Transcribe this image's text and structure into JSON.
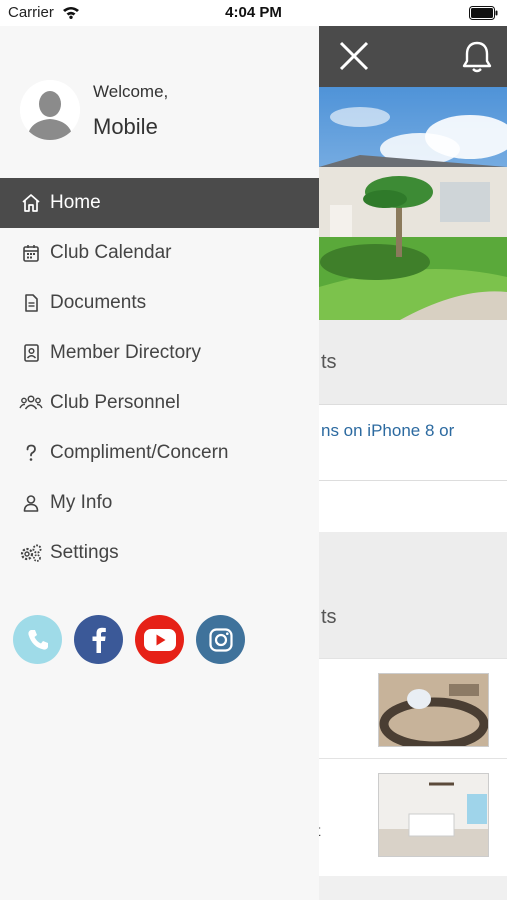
{
  "status_bar": {
    "carrier": "Carrier",
    "time": "4:04 PM"
  },
  "background": {
    "section1_title_fragment": "ts",
    "news_fragment": "ns on iPhone 8 or",
    "section2_title_fragment": "ts",
    "row2_fragment": "t"
  },
  "drawer": {
    "welcome": "Welcome,",
    "username": "Mobile",
    "menu": [
      {
        "label": "Home",
        "icon": "home-icon",
        "active": true
      },
      {
        "label": "Club Calendar",
        "icon": "calendar-icon"
      },
      {
        "label": "Documents",
        "icon": "document-icon"
      },
      {
        "label": "Member Directory",
        "icon": "directory-icon"
      },
      {
        "label": "Club Personnel",
        "icon": "people-icon"
      },
      {
        "label": "Compliment/Concern",
        "icon": "question-icon"
      },
      {
        "label": "My Info",
        "icon": "person-icon"
      },
      {
        "label": "Settings",
        "icon": "gears-icon"
      }
    ],
    "socials": [
      {
        "name": "phone",
        "color": "#9fdbe8"
      },
      {
        "name": "facebook",
        "color": "#3b5998"
      },
      {
        "name": "youtube",
        "color": "#e62117"
      },
      {
        "name": "instagram",
        "color": "#3f729b"
      }
    ]
  },
  "colors": {
    "header": "#4b4b4b",
    "active_item": "#4b4b4b",
    "link": "#2c6aa0"
  }
}
